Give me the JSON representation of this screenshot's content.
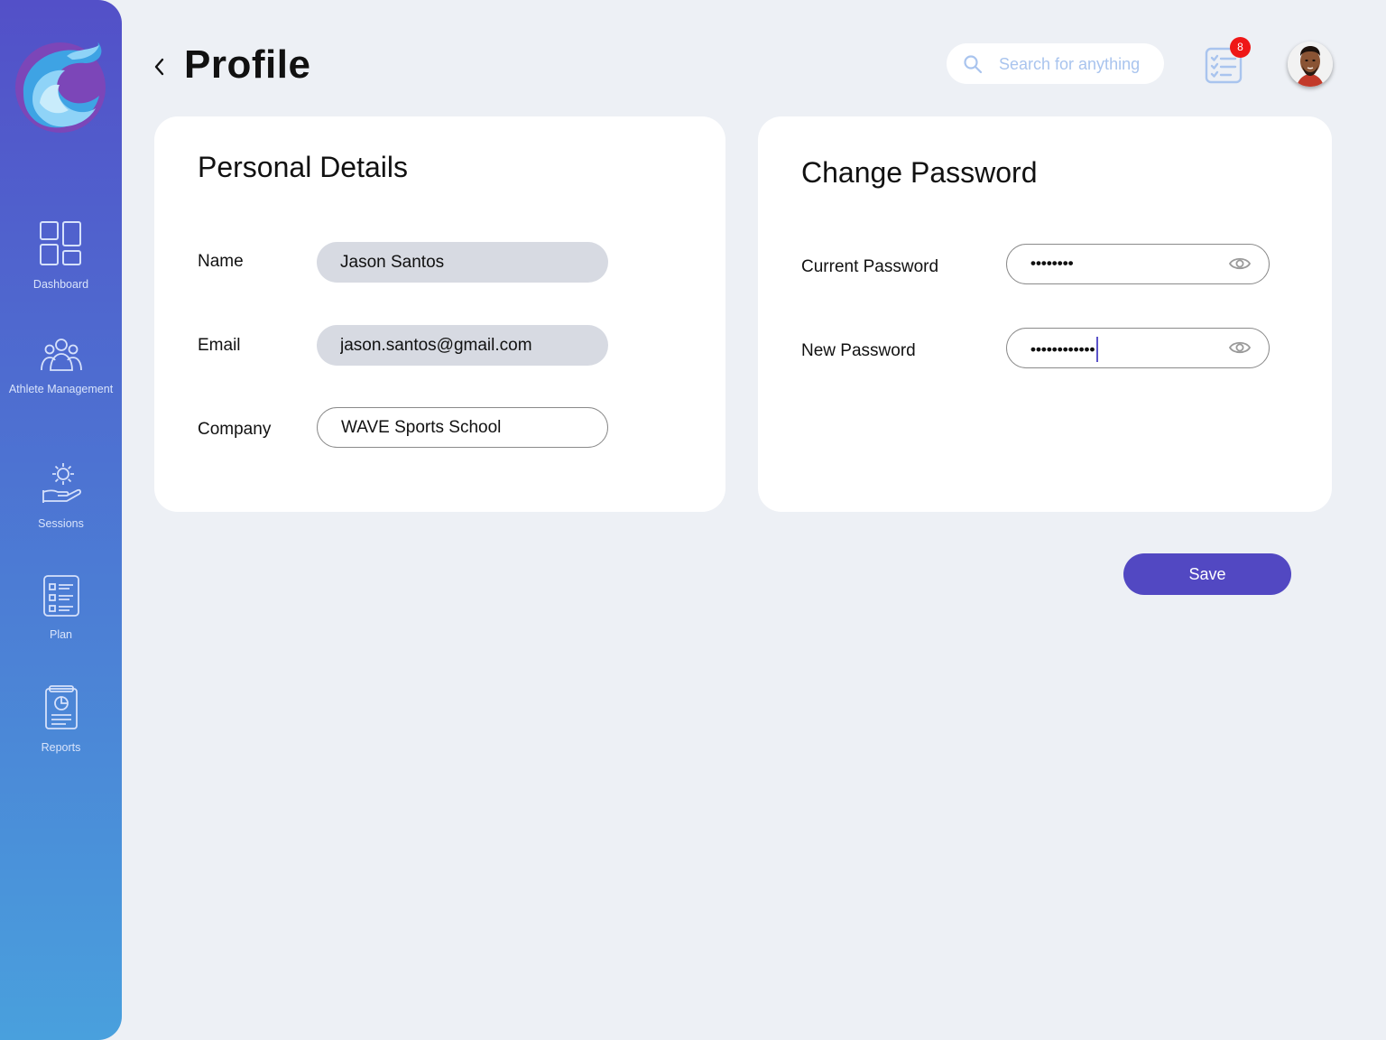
{
  "page": {
    "title": "Profile"
  },
  "search": {
    "placeholder": "Search for anything"
  },
  "notifications": {
    "count": "8"
  },
  "sidebar": {
    "items": [
      {
        "label": "Dashboard",
        "icon": "dashboard-grid-icon"
      },
      {
        "label": "Athlete Management",
        "icon": "people-group-icon"
      },
      {
        "label": "Sessions",
        "icon": "hand-gear-icon"
      },
      {
        "label": "Plan",
        "icon": "checklist-icon"
      },
      {
        "label": "Reports",
        "icon": "report-document-icon"
      }
    ]
  },
  "personal": {
    "title": "Personal Details",
    "name_label": "Name",
    "name_value": "Jason Santos",
    "email_label": "Email",
    "email_value": "jason.santos@gmail.com",
    "company_label": "Company",
    "company_value": "WAVE Sports School"
  },
  "password": {
    "title": "Change Password",
    "current_label": "Current Password",
    "current_mask": "••••••••",
    "new_label": "New Password",
    "new_mask": "••••••••••••"
  },
  "actions": {
    "save_label": "Save"
  },
  "colors": {
    "accent": "#5248c2",
    "sidebar_top": "#5350c8",
    "sidebar_bottom": "#49a0dd",
    "badge": "#ef1717",
    "background": "#edf0f5"
  }
}
